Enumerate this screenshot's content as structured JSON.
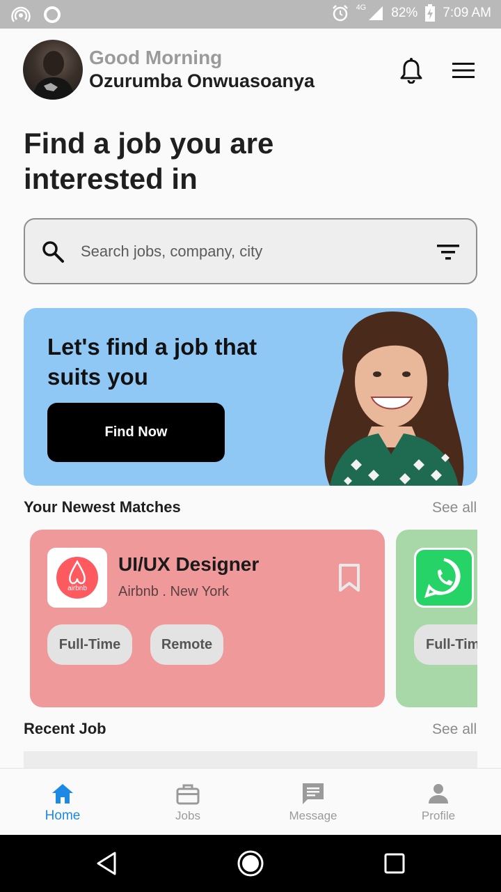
{
  "status_bar": {
    "battery": "82%",
    "time": "7:09 AM",
    "network": "4G"
  },
  "header": {
    "greeting": "Good Morning",
    "user_name": "Ozurumba Onwuasoanya"
  },
  "headline": "Find a job you are interested in",
  "search": {
    "placeholder": "Search jobs, company, city"
  },
  "banner": {
    "title": "Let's find a job that suits you",
    "button_label": "Find Now"
  },
  "newest_matches": {
    "title": "Your Newest Matches",
    "see_all": "See all",
    "cards": [
      {
        "title": "UI/UX Designer",
        "subtitle": "Airbnb . New York",
        "logo_text": "airbnb",
        "tags": [
          "Full-Time",
          "Remote"
        ]
      },
      {
        "tags": [
          "Full-Tim"
        ]
      }
    ]
  },
  "recent_job": {
    "title": "Recent Job",
    "see_all": "See all"
  },
  "bottom_nav": {
    "items": [
      {
        "label": "Home"
      },
      {
        "label": "Jobs"
      },
      {
        "label": "Message"
      },
      {
        "label": "Profile"
      }
    ]
  },
  "colors": {
    "accent": "#1e88e5",
    "banner": "#90c8f5",
    "card_airbnb": "#ef999b",
    "card_whatsapp": "#a8d8a7",
    "airbnb_brand": "#ff5a5f",
    "whatsapp_brand": "#25d366"
  }
}
